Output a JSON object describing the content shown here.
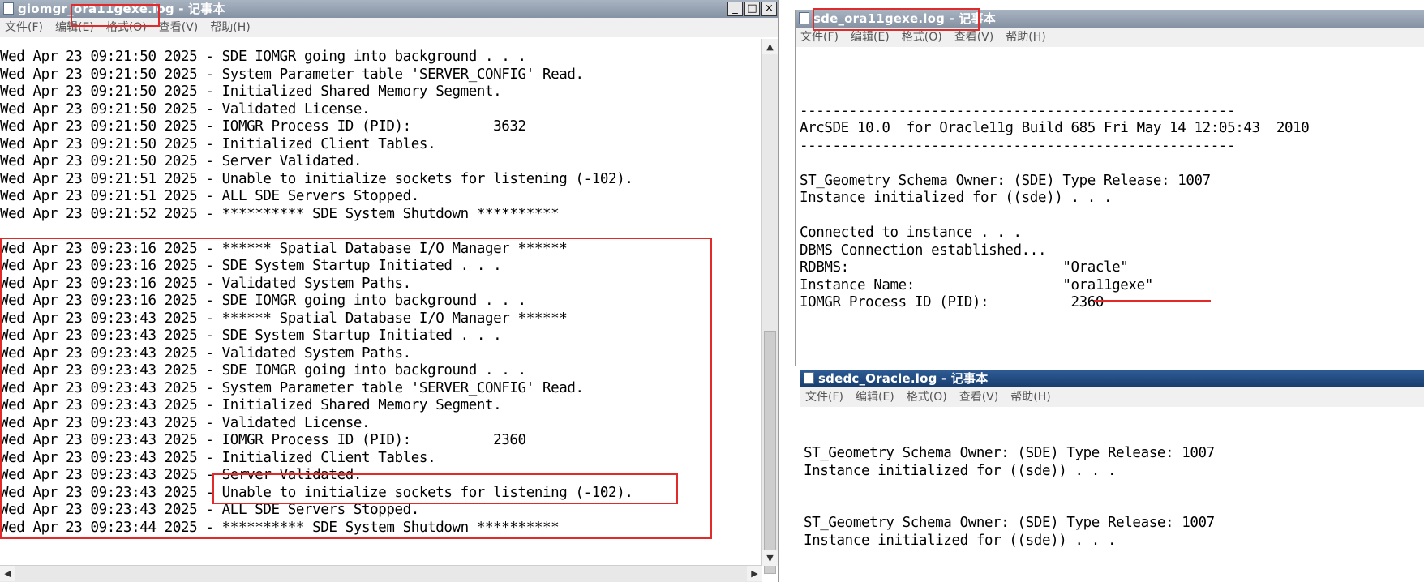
{
  "left_window": {
    "title": "giomgr_ora11gexe.log - 记事本",
    "menu": [
      "文件(F)",
      "编辑(E)",
      "格式(O)",
      "查看(V)",
      "帮助(H)"
    ],
    "controls": [
      "_",
      "□",
      "×"
    ],
    "lines": [
      "Wed Apr 23 09:21:50 2025 - SDE IOMGR going into background . . .",
      "Wed Apr 23 09:21:50 2025 - System Parameter table 'SERVER_CONFIG' Read.",
      "Wed Apr 23 09:21:50 2025 - Initialized Shared Memory Segment.",
      "Wed Apr 23 09:21:50 2025 - Validated License.",
      "Wed Apr 23 09:21:50 2025 - IOMGR Process ID (PID):          3632",
      "Wed Apr 23 09:21:50 2025 - Initialized Client Tables.",
      "Wed Apr 23 09:21:50 2025 - Server Validated.",
      "Wed Apr 23 09:21:51 2025 - Unable to initialize sockets for listening (-102).",
      "Wed Apr 23 09:21:51 2025 - ALL SDE Servers Stopped.",
      "Wed Apr 23 09:21:52 2025 - ********** SDE System Shutdown **********",
      "",
      "Wed Apr 23 09:23:16 2025 - ****** Spatial Database I/O Manager ******",
      "Wed Apr 23 09:23:16 2025 - SDE System Startup Initiated . . .",
      "Wed Apr 23 09:23:16 2025 - Validated System Paths.",
      "Wed Apr 23 09:23:16 2025 - SDE IOMGR going into background . . .",
      "Wed Apr 23 09:23:43 2025 - ****** Spatial Database I/O Manager ******",
      "Wed Apr 23 09:23:43 2025 - SDE System Startup Initiated . . .",
      "Wed Apr 23 09:23:43 2025 - Validated System Paths.",
      "Wed Apr 23 09:23:43 2025 - SDE IOMGR going into background . . .",
      "Wed Apr 23 09:23:43 2025 - System Parameter table 'SERVER_CONFIG' Read.",
      "Wed Apr 23 09:23:43 2025 - Initialized Shared Memory Segment.",
      "Wed Apr 23 09:23:43 2025 - Validated License.",
      "Wed Apr 23 09:23:43 2025 - IOMGR Process ID (PID):          2360",
      "Wed Apr 23 09:23:43 2025 - Initialized Client Tables.",
      "Wed Apr 23 09:23:43 2025 - Server Validated.",
      "Wed Apr 23 09:23:43 2025 - Unable to initialize sockets for listening (-102).",
      "Wed Apr 23 09:23:43 2025 - ALL SDE Servers Stopped.",
      "Wed Apr 23 09:23:44 2025 - ********** SDE System Shutdown **********"
    ]
  },
  "top_right_window": {
    "title": "sde_ora11gexe.log - 记事本",
    "menu": [
      "文件(F)",
      "编辑(E)",
      "格式(O)",
      "查看(V)",
      "帮助(H)"
    ],
    "lines": [
      "",
      "",
      "",
      "-----------------------------------------------------",
      "ArcSDE 10.0  for Oracle11g Build 685 Fri May 14 12:05:43  2010",
      "-----------------------------------------------------",
      "",
      "ST_Geometry Schema Owner: (SDE) Type Release: 1007",
      "Instance initialized for ((sde)) . . .",
      "",
      "Connected to instance . . .",
      "DBMS Connection established...",
      "RDBMS:                          \"Oracle\"",
      "Instance Name:                  \"ora11gexe\"",
      "IOMGR Process ID (PID):          2360"
    ]
  },
  "bottom_right_window": {
    "title": "sdedc_Oracle.log - 记事本",
    "menu": [
      "文件(F)",
      "编辑(E)",
      "格式(O)",
      "查看(V)",
      "帮助(H)"
    ],
    "lines": [
      "",
      "",
      "ST_Geometry Schema Owner: (SDE) Type Release: 1007",
      "Instance initialized for ((sde)) . . .",
      "",
      "",
      "ST_Geometry Schema Owner: (SDE) Type Release: 1007",
      "Instance initialized for ((sde)) . . ."
    ]
  },
  "colors": {
    "highlight": "#e12a2a",
    "active_title": "#1f4a80",
    "inactive_title": "#8f9cad"
  }
}
